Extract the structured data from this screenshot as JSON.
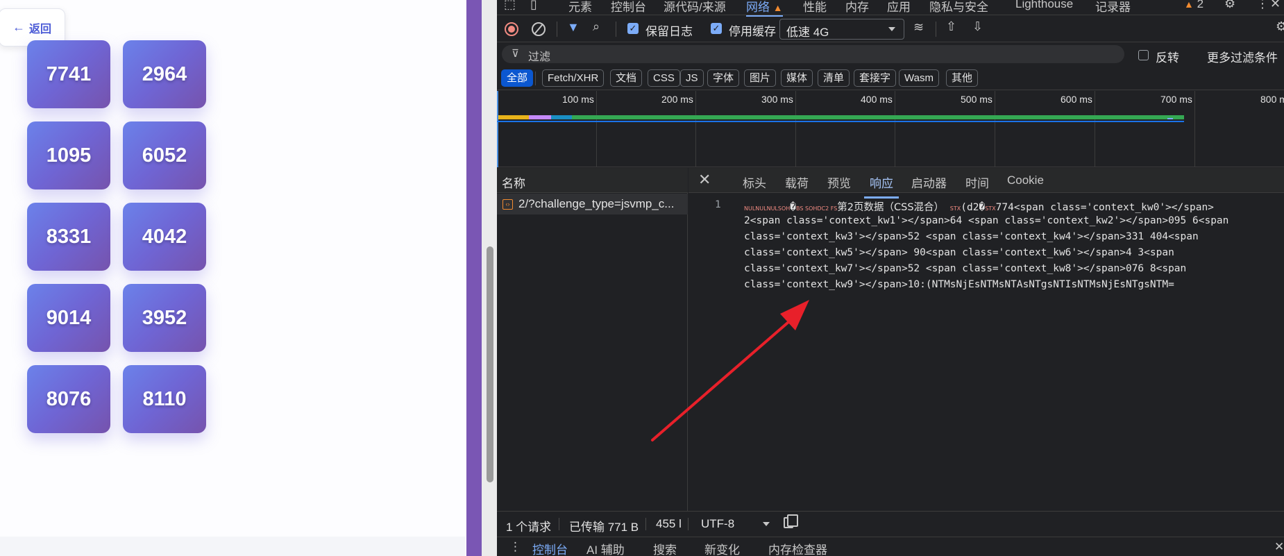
{
  "page": {
    "back_label": "返回",
    "numbers": [
      "7741",
      "2964",
      "1095",
      "6052",
      "8331",
      "4042",
      "9014",
      "3952",
      "8076",
      "8110"
    ]
  },
  "devtools": {
    "tabs": [
      "元素",
      "控制台",
      "源代码/来源",
      "网络",
      "性能",
      "内存",
      "应用",
      "隐私与安全",
      "Lighthouse",
      "记录器"
    ],
    "active_tab": "网络",
    "issues_count": "2",
    "toolbar": {
      "preserve_log": "保留日志",
      "disable_cache": "停用缓存",
      "throttle": "低速 4G"
    },
    "filter": {
      "placeholder": "过滤",
      "invert": "反转",
      "more": "更多过滤条件"
    },
    "types": [
      "全部",
      "Fetch/XHR",
      "文档",
      "CSS",
      "JS",
      "字体",
      "图片",
      "媒体",
      "清单",
      "套接字",
      "Wasm",
      "其他"
    ],
    "timeline_labels": [
      "100 ms",
      "200 ms",
      "300 ms",
      "400 ms",
      "500 ms",
      "600 ms",
      "700 ms",
      "800 ms"
    ],
    "list_header": "名称",
    "request_name": "2/?challenge_type=jsvmp_c...",
    "detail_tabs": [
      "标头",
      "载荷",
      "预览",
      "响应",
      "启动器",
      "时间",
      "Cookie"
    ],
    "active_detail_tab": "响应",
    "response": {
      "line_number": "1",
      "ctrl_prefix": "NULNULNULSOH",
      "ctrl_mid": "BS SOHDC2 FS",
      "line0_text": "第2页数据（CSS混合）",
      "ctrl_stx1": "STX",
      "line0_mid": "(d2",
      "ctrl_stx2": "STX",
      "line0_end": "774<span class='context_kw0'></span>",
      "lines": [
        "2<span class='context_kw1'></span>64 <span class='context_kw2'></span>095 6<span",
        "class='context_kw3'></span>52 <span class='context_kw4'></span>331 404<span",
        "class='context_kw5'></span> 90<span class='context_kw6'></span>4 3<span",
        "class='context_kw7'></span>52 <span class='context_kw8'></span>076 8<span",
        "class='context_kw9'></span>10:(NTMsNjEsNTMsNTAsNTgsNTIsNTMsNjEsNTgsNTM="
      ]
    },
    "status": {
      "requests": "1 个请求",
      "transferred": "已传输 771 B",
      "resources": "455 l",
      "encoding": "UTF-8"
    },
    "drawer_tabs": [
      "控制台",
      "AI 辅助",
      "搜索",
      "新变化",
      "内存检查器"
    ]
  },
  "colors": {
    "card_gradient_start": "#6b82ea",
    "card_gradient_end": "#7653ad",
    "accent_blue": "#7cacf8",
    "annotation_arrow": "#e8202a"
  }
}
